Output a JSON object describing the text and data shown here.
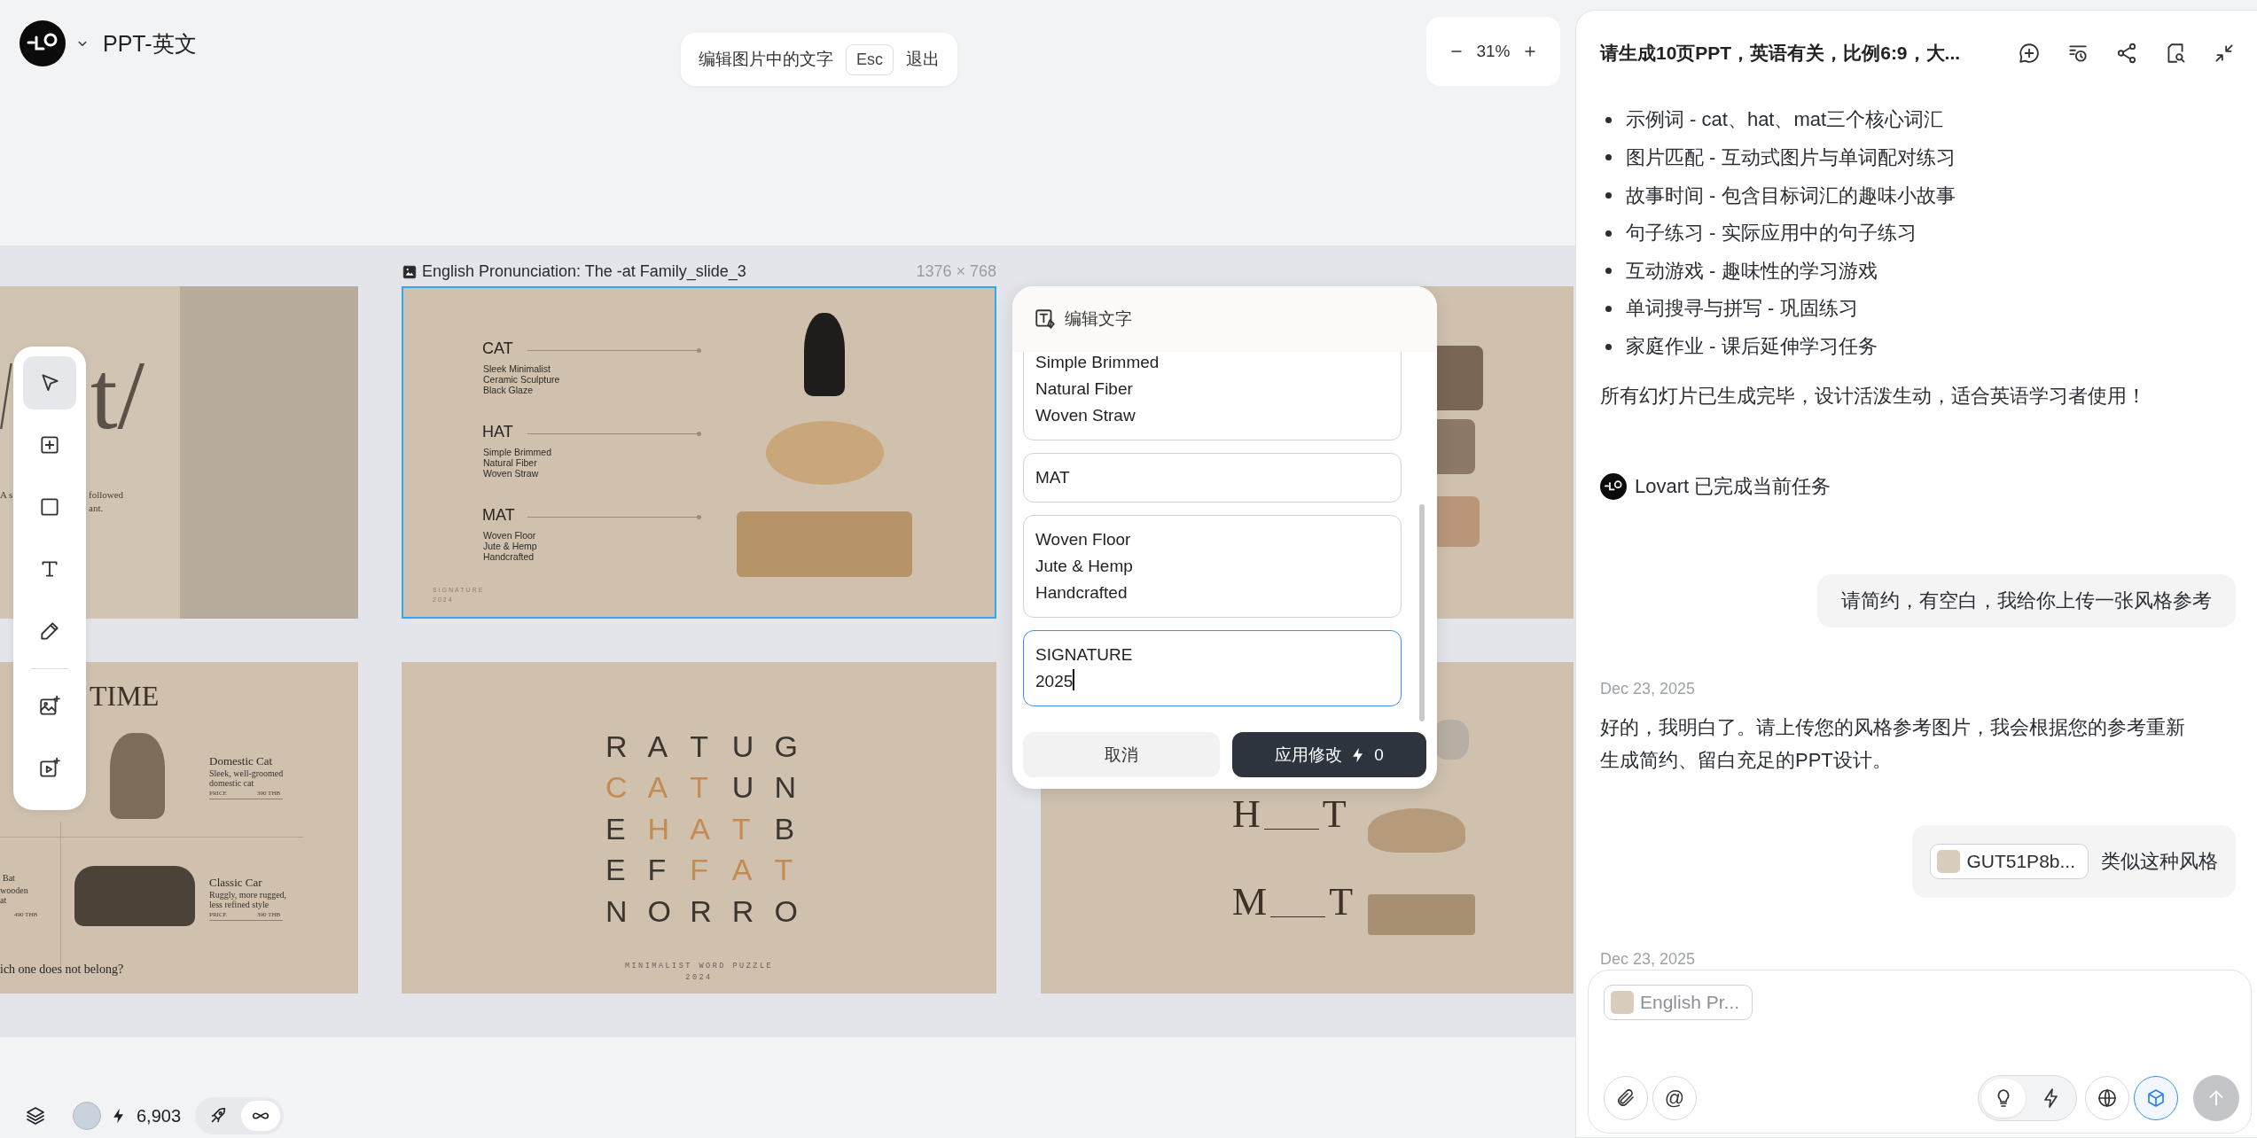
{
  "header": {
    "project_title": "PPT-英文"
  },
  "edit_banner": {
    "message": "编辑图片中的文字",
    "key": "Esc",
    "exit_label": "退出"
  },
  "zoom": {
    "value": "31%"
  },
  "slide_label": {
    "title": "English Pronunciation: The -at Family_slide_3",
    "size": "1376 × 768"
  },
  "slides": [
    {
      "kind": "title",
      "selected": false,
      "title_fragments": [
        "/",
        "t/"
      ],
      "body_fragments": [
        "A s",
        "followed",
        "ant."
      ]
    },
    {
      "kind": "product_list",
      "selected": true,
      "items": [
        {
          "name": "CAT",
          "details": "Sleek Minimalist\nCeramic Sculpture\nBlack Glaze"
        },
        {
          "name": "HAT",
          "details": "Simple Brimmed\nNatural Fiber\nWoven Straw"
        },
        {
          "name": "MAT",
          "details": "Woven Floor\nJute & Hemp\nHandcrafted"
        }
      ],
      "signature": "SIGNATURE\n2024"
    },
    {
      "kind": "photo_column",
      "selected": false
    },
    {
      "kind": "catalog",
      "selected": false,
      "title_fragments": [
        "TIME"
      ],
      "products": [
        {
          "name": "Domestic Cat",
          "description": "Sleek, well-groomed\ndomestic cat",
          "price_label": "PRICE",
          "price": "390 THB"
        },
        {
          "name": "Classic Car",
          "description": "Ruggly, more rugged,\nless refined style",
          "price_label": "PRICE",
          "price": "390 THB"
        }
      ],
      "left_fragments": [
        "Bat",
        "wooden",
        "at"
      ],
      "left_price": "490 THB",
      "question": "ich one does not belong?"
    },
    {
      "kind": "word_puzzle",
      "selected": false,
      "rows": [
        [
          {
            "letter": "R",
            "highlighted": false
          },
          {
            "letter": "A",
            "highlighted": false
          },
          {
            "letter": "T",
            "highlighted": false
          },
          {
            "letter": "U",
            "highlighted": false
          },
          {
            "letter": "G",
            "highlighted": false
          }
        ],
        [
          {
            "letter": "C",
            "highlighted": true
          },
          {
            "letter": "A",
            "highlighted": true
          },
          {
            "letter": "T",
            "highlighted": true
          },
          {
            "letter": "U",
            "highlighted": false
          },
          {
            "letter": "N",
            "highlighted": false
          }
        ],
        [
          {
            "letter": "E",
            "highlighted": false
          },
          {
            "letter": "H",
            "highlighted": true
          },
          {
            "letter": "A",
            "highlighted": true
          },
          {
            "letter": "T",
            "highlighted": true
          },
          {
            "letter": "B",
            "highlighted": false
          }
        ],
        [
          {
            "letter": "E",
            "highlighted": false
          },
          {
            "letter": "F",
            "highlighted": false
          },
          {
            "letter": "F",
            "highlighted": true
          },
          {
            "letter": "A",
            "highlighted": true
          },
          {
            "letter": "T",
            "highlighted": true
          }
        ],
        [
          {
            "letter": "N",
            "highlighted": false
          },
          {
            "letter": "O",
            "highlighted": false
          },
          {
            "letter": "R",
            "highlighted": false
          },
          {
            "letter": "R",
            "highlighted": false
          },
          {
            "letter": "O",
            "highlighted": false
          }
        ]
      ],
      "caption": "MINIMALIST WORD PUZZLE",
      "year": "2024"
    },
    {
      "kind": "fill_blank",
      "selected": false,
      "words": [
        {
          "first": "H",
          "last": "T"
        },
        {
          "first": "M",
          "last": "T"
        }
      ]
    }
  ],
  "tools": [
    {
      "kind": "select",
      "selected": true
    },
    {
      "kind": "add",
      "selected": false
    },
    {
      "kind": "shape",
      "selected": false
    },
    {
      "kind": "text",
      "selected": false
    },
    {
      "kind": "pen",
      "selected": false
    },
    {
      "kind": "image",
      "selected": false
    },
    {
      "kind": "video",
      "selected": false
    }
  ],
  "text_editor": {
    "title": "编辑文字",
    "fields": [
      {
        "value": "Simple Brimmed\nNatural Fiber\nWoven Straw",
        "focused": false
      },
      {
        "value": "MAT",
        "focused": false
      },
      {
        "value": "Woven Floor\nJute & Hemp\nHandcrafted",
        "focused": false
      },
      {
        "value": "SIGNATURE\n2025",
        "focused": true
      }
    ],
    "cancel_label": "取消",
    "apply_label": "应用修改",
    "apply_cost": "0"
  },
  "footer": {
    "credits": "6,903",
    "modes": [
      {
        "kind": "rocket",
        "selected": false
      },
      {
        "kind": "infinity",
        "selected": true
      }
    ]
  },
  "chat": {
    "title": "请生成10页PPT，英语有关，比例6:9，大...",
    "bullets": [
      "示例词 - cat、hat、mat三个核心词汇",
      "图片匹配 - 互动式图片与单词配对练习",
      "故事时间 - 包含目标词汇的趣味小故事",
      "句子练习 - 实际应用中的句子练习",
      "互动游戏 - 趣味性的学习游戏",
      "单词搜寻与拼写 - 巩固练习",
      "家庭作业 - 课后延伸学习任务"
    ],
    "summary": "所有幻灯片已生成完毕，设计活泼生动，适合英语学习者使用！",
    "status": "Lovart 已完成当前任务",
    "messages": [
      {
        "kind": "user",
        "text": "请简约，有空白，我给你上传一张风格参考"
      },
      {
        "kind": "date",
        "text": "Dec 23, 2025"
      },
      {
        "kind": "assistant",
        "text": "好的，我明白了。请上传您的风格参考图片，我会根据您的参考重新生成简约、留白充足的PPT设计。"
      },
      {
        "kind": "user_attachment",
        "attachment": "GUT51P8b...",
        "text": "类似这种风格"
      },
      {
        "kind": "date",
        "text": "Dec 23, 2025"
      }
    ],
    "composer": {
      "attachment": "English Pr...",
      "mention_symbol": "@",
      "modes": [
        {
          "kind": "idea",
          "selected": true
        },
        {
          "kind": "fast",
          "selected": false
        }
      ],
      "web_search_on": false,
      "agent_on": true,
      "send_enabled": false
    }
  }
}
